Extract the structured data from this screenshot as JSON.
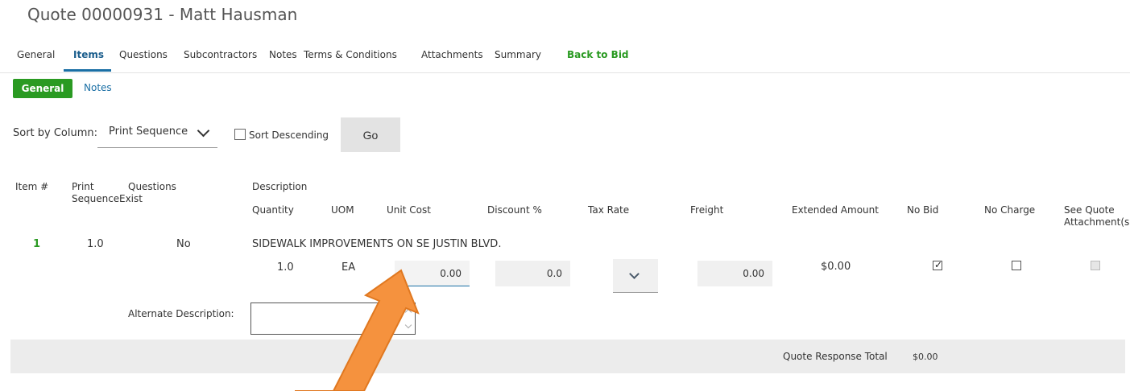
{
  "page_title": "Quote 00000931 - Matt Hausman",
  "tabs": [
    {
      "label": "General"
    },
    {
      "label": "Items"
    },
    {
      "label": "Questions"
    },
    {
      "label": "Subcontractors"
    },
    {
      "label": "Notes"
    },
    {
      "label": "Terms & Conditions"
    },
    {
      "label": "Attachments"
    },
    {
      "label": "Summary"
    },
    {
      "label": "Back to Bid"
    }
  ],
  "subtabs": {
    "general": "General",
    "notes": "Notes"
  },
  "sort": {
    "label": "Sort by Column:",
    "selected": "Print Sequence",
    "descending_label": "Sort Descending",
    "descending_checked": false,
    "go_label": "Go"
  },
  "columns": {
    "item_num": "Item #",
    "print_sequence": "Print Sequence",
    "questions_exist": "Questions Exist",
    "description": "Description",
    "quantity": "Quantity",
    "uom": "UOM",
    "unit_cost": "Unit Cost",
    "discount": "Discount %",
    "tax_rate": "Tax Rate",
    "freight": "Freight",
    "extended_amount": "Extended Amount",
    "no_bid": "No Bid",
    "no_charge": "No Charge",
    "see_quote_attachments": "See Quote Attachment(s)"
  },
  "item": {
    "number": "1",
    "print_sequence": "1.0",
    "questions_exist": "No",
    "description": "SIDEWALK IMPROVEMENTS ON SE JUSTIN BLVD.",
    "quantity": "1.0",
    "uom": "EA",
    "unit_cost": "0.00",
    "discount": "0.0",
    "tax_rate": "",
    "freight": "0.00",
    "extended_amount": "$0.00",
    "no_bid": true,
    "no_charge": false,
    "see_quote_attachments": false,
    "alternate_description_label": "Alternate Description:",
    "alternate_description": ""
  },
  "total": {
    "label": "Quote Response Total",
    "value": "$0.00"
  },
  "colors": {
    "accent_green": "#2a9a22",
    "link_blue": "#1a6fa5",
    "arrow_orange": "#f5923e"
  }
}
